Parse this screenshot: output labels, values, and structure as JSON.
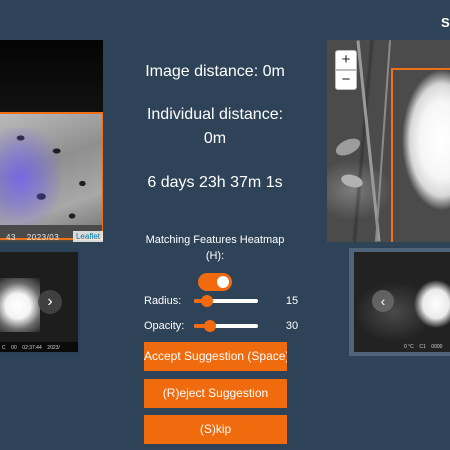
{
  "header": {
    "corner_text": "S"
  },
  "left_image": {
    "timestamp": "43    2023/03",
    "attribution": "Leaflet"
  },
  "left_thumbnail": {
    "timestamp": "C    00    02:37:44    2023/",
    "next_icon": "chevron-right-icon"
  },
  "stats": {
    "image_distance": "Image distance: 0m",
    "individual_distance_label": "Individual distance:",
    "individual_distance_value": "0m",
    "time_difference": "6 days 23h 37m 1s"
  },
  "heatmap": {
    "label": "Matching Features Heatmap (H):",
    "enabled": true
  },
  "sliders": {
    "radius": {
      "label": "Radius:",
      "value": "15",
      "level": 0.2
    },
    "opacity": {
      "label": "Opacity:",
      "value": "30",
      "level": 0.25
    }
  },
  "buttons": {
    "accept": "Accept Suggestion (Space)",
    "reject": "(R)eject Suggestion",
    "skip": "(S)kip"
  },
  "right_image": {
    "zoom_in": "+",
    "zoom_out": "−"
  },
  "right_thumbnail": {
    "timestamp": "0 °C    C1    0000",
    "prev_icon": "chevron-left-icon"
  },
  "colors": {
    "background": "#2e4357",
    "accent": "#f06a0e",
    "heatmap": "#705aff"
  }
}
